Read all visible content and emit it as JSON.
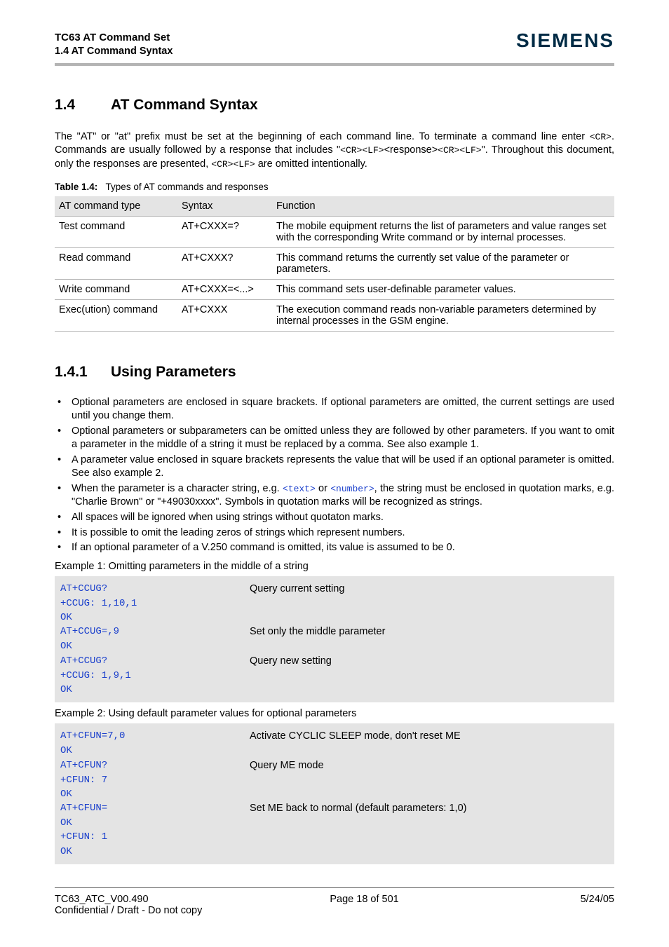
{
  "header": {
    "doc_title": "TC63 AT Command Set",
    "section_ref": "1.4 AT Command Syntax",
    "logo": "SIEMENS"
  },
  "section": {
    "num": "1.4",
    "title": "AT Command Syntax",
    "intro_parts": {
      "p1": "The \"AT\" or \"at\" prefix must be set at the beginning of each command line. To terminate a command line enter ",
      "code1": "<CR>",
      "p2": ". Commands are usually followed by a response that includes \"",
      "code2": "<CR><LF>",
      "p3": "<response>",
      "code3": "<CR><LF>",
      "p4": "\". Throughout this document, only the responses are presented, ",
      "code4": "<CR><LF>",
      "p5": " are omitted intentionally."
    }
  },
  "table": {
    "caption_bold": "Table 1.4:",
    "caption_text": "Types of AT commands and responses",
    "headers": [
      "AT command type",
      "Syntax",
      "Function"
    ],
    "rows": [
      [
        "Test command",
        "AT+CXXX=?",
        "The mobile equipment returns the list of parameters and value ranges set with the corresponding Write command or by internal processes."
      ],
      [
        "Read command",
        "AT+CXXX?",
        "This command returns the currently set value of the parameter or parameters."
      ],
      [
        "Write command",
        "AT+CXXX=<...>",
        "This command sets user-definable parameter values."
      ],
      [
        "Exec(ution) command",
        "AT+CXXX",
        "The execution command reads non-variable parameters determined by internal processes in the GSM engine."
      ]
    ]
  },
  "subsection": {
    "num": "1.4.1",
    "title": "Using Parameters",
    "bullets": [
      {
        "text": "Optional parameters are enclosed in square brackets. If optional parameters are omitted, the current settings are used until you change them."
      },
      {
        "text": "Optional parameters or subparameters can be omitted unless they are followed by other parameters. If you want to omit a parameter in the middle of a string it must be replaced by a comma. See also example 1."
      },
      {
        "text": "A parameter value enclosed in square brackets represents the value that will be used if an optional parameter is omitted. See also example 2."
      },
      {
        "pre": "When the parameter is a character string, e.g. ",
        "code1": "<text>",
        "mid": " or ",
        "code2": "<number>",
        "post": ", the string must be enclosed in quotation marks, e.g. \"Charlie Brown\" or \"+49030xxxx\". Symbols in quotation marks will be recognized as strings."
      },
      {
        "text": "All spaces will be ignored when using strings without quotaton marks."
      },
      {
        "text": "It is possible to omit the leading zeros of strings which represent numbers."
      },
      {
        "text": "If an optional parameter of a V.250 command is omitted, its value is assumed to be 0."
      }
    ],
    "example1_label": "Example 1: Omitting parameters in the middle of a string",
    "example1": [
      {
        "code": "AT+CCUG?",
        "desc": "Query current setting"
      },
      {
        "code": "+CCUG: 1,10,1",
        "desc": ""
      },
      {
        "code": "OK",
        "desc": ""
      },
      {
        "code": "AT+CCUG=,9",
        "desc": "Set only the middle parameter"
      },
      {
        "code": "OK",
        "desc": ""
      },
      {
        "code": "AT+CCUG?",
        "desc": "Query new setting"
      },
      {
        "code": "+CCUG: 1,9,1",
        "desc": ""
      },
      {
        "code": "OK",
        "desc": ""
      }
    ],
    "example2_label": "Example 2: Using default parameter values for optional parameters",
    "example2": [
      {
        "code": "AT+CFUN=7,0",
        "desc": "Activate CYCLIC SLEEP mode, don't reset ME"
      },
      {
        "code": "OK",
        "desc": ""
      },
      {
        "code": "AT+CFUN?",
        "desc": "Query ME mode"
      },
      {
        "code": "+CFUN: 7",
        "desc": ""
      },
      {
        "code": "OK",
        "desc": ""
      },
      {
        "code": "AT+CFUN=",
        "desc": "Set ME back to normal (default parameters: 1,0)"
      },
      {
        "code": "OK",
        "desc": ""
      },
      {
        "code": "+CFUN: 1",
        "desc": ""
      },
      {
        "code": "OK",
        "desc": ""
      }
    ]
  },
  "footer": {
    "left": "TC63_ATC_V00.490",
    "mid": "Page 18 of 501",
    "right": "5/24/05",
    "conf": "Confidential / Draft - Do not copy"
  }
}
